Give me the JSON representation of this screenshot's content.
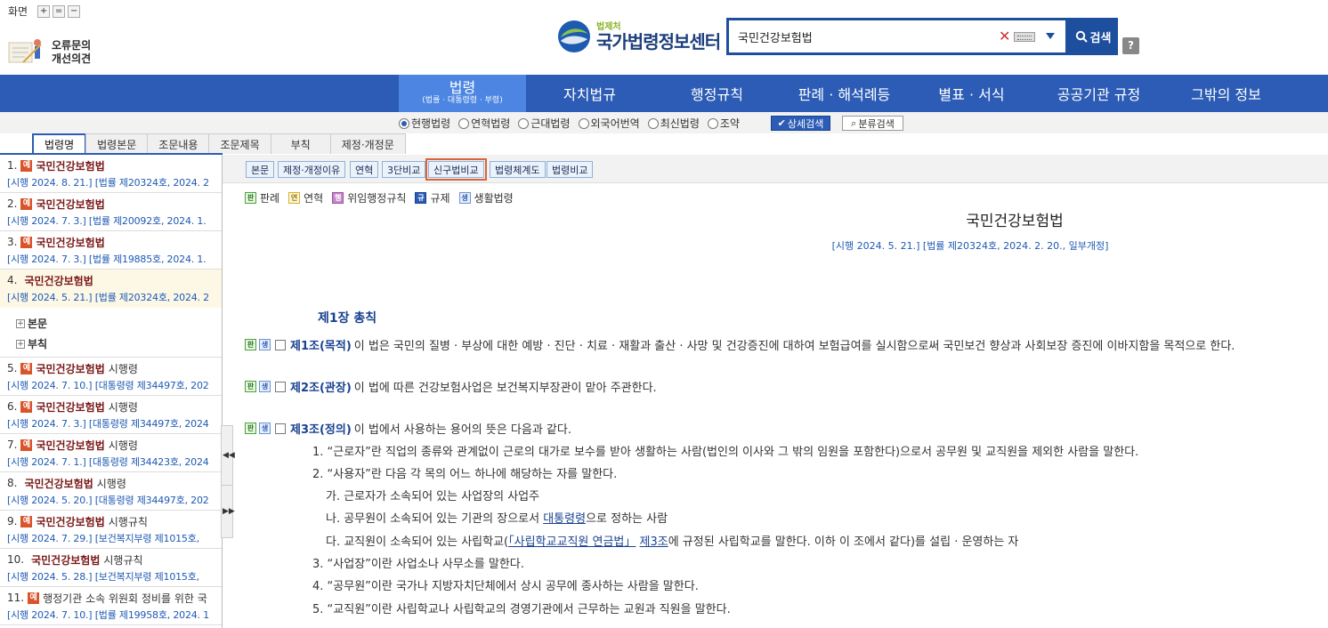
{
  "header": {
    "screen_label": "화면",
    "screen_buttons": [
      "+",
      "=",
      "−"
    ],
    "report_line1": "오류문의",
    "report_line2": "개선의견",
    "logo_sub": "법제처",
    "logo_main": "국가법령정보센터",
    "search_value": "국민건강보험법",
    "search_button": "검색",
    "help_button": "?"
  },
  "nav": {
    "items": [
      {
        "label": "법령",
        "sub": "(법률 · 대통령령 · 부령)"
      },
      {
        "label": "자치법규"
      },
      {
        "label": "행정규칙"
      },
      {
        "label": "판례 · 해석례등"
      },
      {
        "label": "별표 · 서식"
      },
      {
        "label": "공공기관 규정"
      },
      {
        "label": "그밖의 정보"
      }
    ]
  },
  "filter": {
    "radios": [
      "현행법령",
      "연혁법령",
      "근대법령",
      "외국어번역",
      "최신법령",
      "조약"
    ],
    "selected": "현행법령",
    "detail_search": "상세검색",
    "category_search": "분류검색"
  },
  "left_tabs": [
    "법령명",
    "법령본문",
    "조문내용",
    "조문제목",
    "부칙",
    "제정·개정문"
  ],
  "left_list": [
    {
      "num": "1.",
      "badge": true,
      "name": "국민건강보험법",
      "kind": "",
      "detail": "[시행 2024. 8. 21.] [법률 제20324호, 2024. 2"
    },
    {
      "num": "2.",
      "badge": true,
      "name": "국민건강보험법",
      "kind": "",
      "detail": "[시행 2024. 7. 3.] [법률 제20092호, 2024. 1."
    },
    {
      "num": "3.",
      "badge": true,
      "name": "국민건강보험법",
      "kind": "",
      "detail": "[시행 2024. 7. 3.] [법률 제19885호, 2024. 1."
    },
    {
      "num": "4.",
      "badge": false,
      "name": "국민건강보험법",
      "kind": "",
      "detail": "[시행 2024. 5. 21.] [법률 제20324호, 2024. 2"
    },
    {
      "num": "5.",
      "badge": true,
      "name": "국민건강보험법",
      "kind": "시행령",
      "detail": "[시행 2024. 7. 10.] [대통령령 제34497호, 202"
    },
    {
      "num": "6.",
      "badge": true,
      "name": "국민건강보험법",
      "kind": "시행령",
      "detail": "[시행 2024. 7. 3.] [대통령령 제34497호, 2024"
    },
    {
      "num": "7.",
      "badge": true,
      "name": "국민건강보험법",
      "kind": "시행령",
      "detail": "[시행 2024. 7. 1.] [대통령령 제34423호, 2024"
    },
    {
      "num": "8.",
      "badge": false,
      "name": "국민건강보험법",
      "kind": "시행령",
      "detail": "[시행 2024. 5. 20.] [대통령령 제34497호, 202"
    },
    {
      "num": "9.",
      "badge": true,
      "name": "국민건강보험법",
      "kind": "시행규칙",
      "detail": "[시행 2024. 7. 29.] [보건복지부령 제1015호,"
    },
    {
      "num": "10.",
      "badge": false,
      "name": "국민건강보험법",
      "kind": "시행규칙",
      "detail": "[시행 2024. 5. 28.] [보건복지부령 제1015호,"
    },
    {
      "num": "11.",
      "badge": true,
      "name": "",
      "kind": "행정기관 소속 위원회 정비를 위한 국",
      "detail": "[시행 2024. 7. 10.] [법률 제19958호, 2024. 1"
    }
  ],
  "left_tree": [
    "본문",
    "부칙"
  ],
  "badge_char": "예",
  "toolbar": [
    "본문",
    "제정·개정이유",
    "연혁",
    "3단비교",
    "신구법비교",
    "법령체계도",
    "법령비교"
  ],
  "legend": [
    {
      "icon": "판",
      "label": "판례"
    },
    {
      "icon": "연",
      "label": "연혁"
    },
    {
      "icon": "행",
      "label": "위임행정규칙"
    },
    {
      "icon": "규",
      "label": "규제"
    },
    {
      "icon": "생",
      "label": "생활법령"
    }
  ],
  "doc": {
    "title": "국민건강보험법",
    "subtitle": "[시행 2024. 5. 21.] [법률 제20324호, 2024. 2. 20., 일부개정]",
    "chapter": "제1장 총칙",
    "articles": [
      {
        "head": "제1조(목적)",
        "text": "이 법은 국민의 질병 · 부상에 대한 예방 · 진단 · 치료 · 재활과 출산 · 사망 및 건강증진에 대하여 보험급여를 실시함으로써 국민보건 향상과 사회보장 증진에 이바지함을 목적으로 한다."
      },
      {
        "head": "제2조(관장)",
        "text": "이 법에 따른 건강보험사업은 보건복지부장관이 맡아 주관한다."
      },
      {
        "head": "제3조(정의)",
        "text": "이 법에서 사용하는 용어의 뜻은 다음과 같다."
      }
    ],
    "items": [
      "1. “근로자”란 직업의 종류와 관계없이 근로의 대가로 보수를 받아 생활하는 사람(법인의 이사와 그 밖의 임원을 포함한다)으로서 공무원 및 교직원을 제외한 사람을 말한다.",
      "2. “사용자”란 다음 각 목의 어느 하나에 해당하는 자를 말한다.",
      "가. 근로자가 소속되어 있는 사업장의 사업주",
      "3. “사업장”이란 사업소나 사무소를 말한다.",
      "4. “공무원”이란 국가나 지방자치단체에서 상시 공무에 종사하는 사람을 말한다.",
      "5. “교직원”이란 사립학교나 사립학교의 경영기관에서 근무하는 교원과 직원을 말한다."
    ],
    "item_na_pre": "나. 공무원이 소속되어 있는 기관의 장으로서 ",
    "item_na_link": "대통령령",
    "item_na_post": "으로 정하는 사람",
    "item_da_pre": "다. 교직원이 소속되어 있는 사립학교(",
    "item_da_link1": "「사립학교교직원 연금법」",
    "item_da_link2": "제3조",
    "item_da_post": "에 규정된 사립학교를 말한다. 이하 이 조에서 같다)를 설립 · 운영하는 자"
  }
}
